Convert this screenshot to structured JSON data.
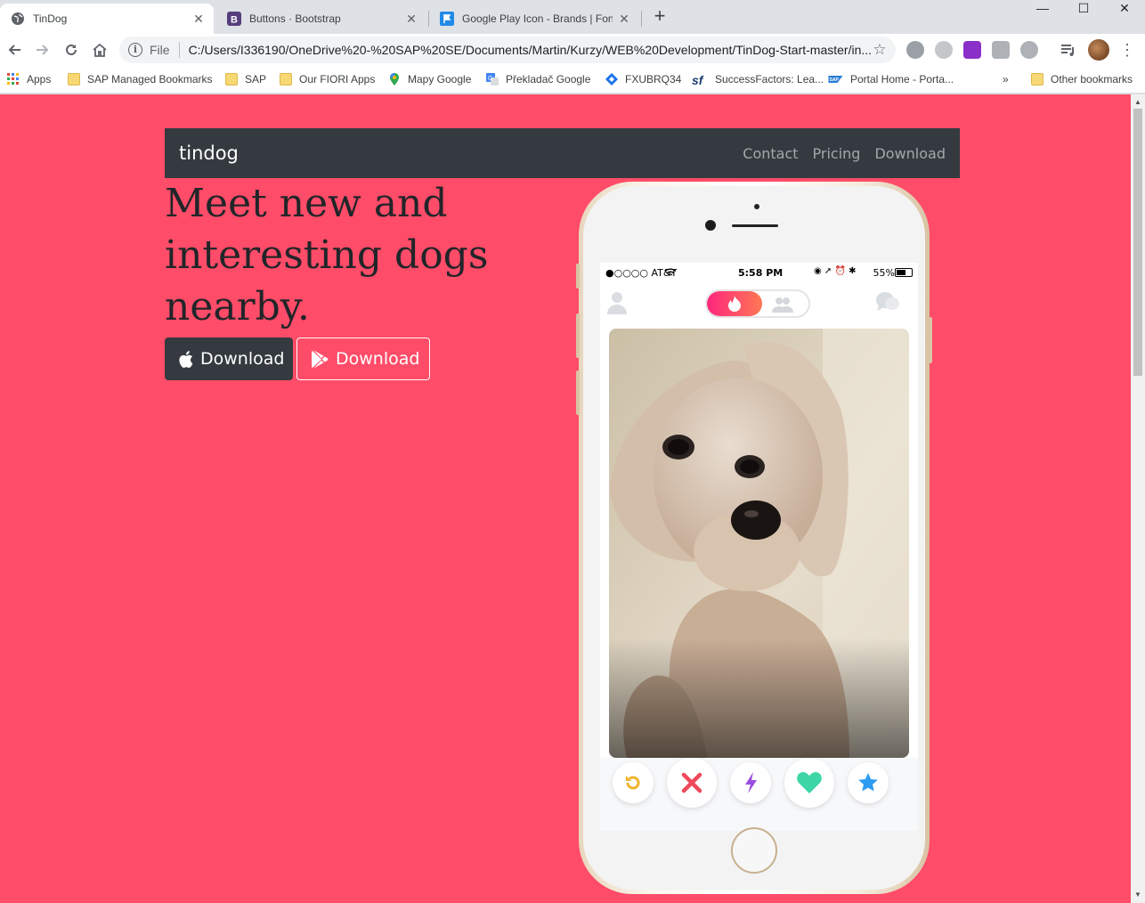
{
  "browser": {
    "tabs": [
      {
        "title": "TinDog",
        "active": true
      },
      {
        "title": "Buttons · Bootstrap",
        "active": false
      },
      {
        "title": "Google Play Icon - Brands | Font Awesome",
        "active": false
      }
    ],
    "address": {
      "scheme": "File",
      "url": "C:/Users/I336190/OneDrive%20-%20SAP%20SE/Documents/Martin/Kurzy/WEB%20Development/TinDog-Start-master/in..."
    },
    "bookmarks": [
      {
        "label": "Apps",
        "icon": "apps-grid-icon"
      },
      {
        "label": "SAP Managed Bookmarks",
        "icon": "folder-icon"
      },
      {
        "label": "SAP",
        "icon": "folder-icon"
      },
      {
        "label": "Our FIORI Apps",
        "icon": "folder-icon"
      },
      {
        "label": "Mapy Google",
        "icon": "map-pin-icon"
      },
      {
        "label": "Překladač Google",
        "icon": "translate-icon"
      },
      {
        "label": "FXUBRQ34",
        "icon": "diamond-icon"
      },
      {
        "label": "SuccessFactors: Lea...",
        "icon": "sf-icon"
      },
      {
        "label": "Portal Home - Porta...",
        "icon": "sap-icon"
      }
    ],
    "overflow": "»",
    "other_bookmarks": "Other bookmarks"
  },
  "site": {
    "brand": "tindog",
    "nav": [
      "Contact",
      "Pricing",
      "Download"
    ],
    "headline": "Meet new and interesting dogs nearby.",
    "buttons": {
      "apple": "Download",
      "play": "Download"
    },
    "colors": {
      "background": "#ff4c68",
      "navbar": "#343a40"
    }
  },
  "phone": {
    "status": {
      "carrier": "●○○○○ AT&T",
      "time": "5:58 PM",
      "battery": "55%"
    },
    "actions": [
      "rewind-icon",
      "nope-icon",
      "boost-icon",
      "like-icon",
      "super-like-icon"
    ]
  }
}
